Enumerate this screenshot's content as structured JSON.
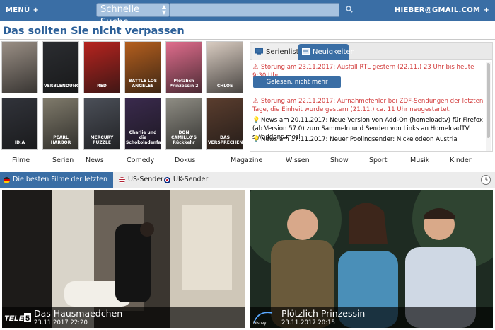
{
  "topbar": {
    "menu_label": "MENÜ",
    "menu_plus": "+",
    "search_type": "Schnelle Suche",
    "search_value": "",
    "user_email": "HIEBER@GMAIL.COM",
    "user_plus": "+"
  },
  "heading": "Das sollten Sie nicht verpassen",
  "posters": [
    {
      "title": "",
      "color": "#9a8f85"
    },
    {
      "title": "VERBLENDUNG",
      "color": "#2b2d31"
    },
    {
      "title": "RED",
      "color": "#b7241f"
    },
    {
      "title": "BATTLE LOS ANGELES",
      "color": "#b45f1e"
    },
    {
      "title": "Plötzlich Prinzessin 2",
      "color": "#e06d8d"
    },
    {
      "title": "CHLOE",
      "color": "#d9ccc1"
    },
    {
      "title": "ID:A",
      "color": "#31333a"
    },
    {
      "title": "PEARL HARBOR",
      "color": "#7f7a6b"
    },
    {
      "title": "MERCURY PUZZLE",
      "color": "#4b4f58"
    },
    {
      "title": "Charlie und die Schokoladenfabrik",
      "color": "#3a2a4d"
    },
    {
      "title": "DON CAMILLO'S Rückkehr",
      "color": "#8e8c83"
    },
    {
      "title": "DAS VERSPRECHEN",
      "color": "#5a3d2e"
    }
  ],
  "side_tabs": [
    {
      "label": "Serienliste",
      "active": false
    },
    {
      "label": "Neuigkeiten",
      "active": true
    }
  ],
  "news": {
    "item1": "Störung am 23.11.2017: Ausfall RTL gestern (22.11.) 23 Uhr bis heute 9:30 Uhr",
    "read_button": "Gelesen, nicht mehr anzeigen",
    "item2": "Störung am 22.11.2017: Aufnahmefehler bei ZDF-Sendungen der letzten Tage, die Einheit wurde gestern (21.11.) ca. 11 Uhr neugestartet.",
    "item3": "News am 20.11.2017: Neue Version von Add-On (homeloadtv) für Firefox (ab Version 57.0) zum Sammeln und Senden von Links an HomeloadTV: s://addons.mozi",
    "item4": "News am 17.11.2017: Neuer Poolingsender: Nickelodeon Austria"
  },
  "categories": [
    "Filme",
    "Serien",
    "News",
    "Comedy",
    "Dokus",
    "Magazine",
    "Wissen",
    "Show",
    "Sport",
    "Musik",
    "Kinder"
  ],
  "sub_tabs": {
    "best": "Die besten Filme der letzten Tage",
    "us": "US-Sender",
    "uk": "UK-Sender"
  },
  "movies": [
    {
      "title": "Das Hausmaedchen",
      "time": "23.11.2017 22:20",
      "channel": "TELE 5"
    },
    {
      "title": "Plötzlich Prinzessin",
      "time": "23.11.2017 20:15",
      "channel": "Disney Channel"
    }
  ],
  "colors": {
    "topbar": "#3a6ea5",
    "heading": "#2b5f98",
    "warning": "#d23c3c"
  }
}
